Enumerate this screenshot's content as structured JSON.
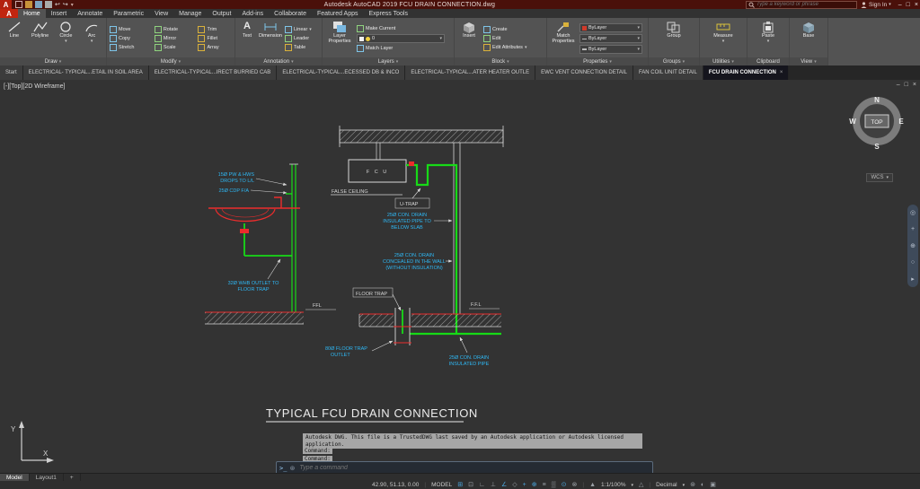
{
  "titlebar": {
    "title": "Autodesk AutoCAD 2019   FCU DRAIN CONNECTION.dwg",
    "search_placeholder": "Type a keyword or phrase",
    "signin": "Sign In"
  },
  "icons": {
    "minimize": "–",
    "maximize": "□",
    "close": "×",
    "undo": "↩",
    "redo": "↪",
    "prompt": ">_",
    "customize": "⊛",
    "dropdown": "▾"
  },
  "ribbon": {
    "tabs": [
      "Home",
      "Insert",
      "Annotate",
      "Parametric",
      "View",
      "Manage",
      "Output",
      "Add-ins",
      "Collaborate",
      "Featured Apps",
      "Express Tools"
    ],
    "draw": {
      "label": "Draw",
      "items": [
        "Line",
        "Polyline",
        "Circle",
        "Arc"
      ]
    },
    "modify": {
      "label": "Modify",
      "items": [
        "Move",
        "Rotate",
        "Trim",
        "Copy",
        "Mirror",
        "Fillet",
        "Stretch",
        "Scale",
        "Array"
      ]
    },
    "annotation": {
      "label": "Annotation",
      "big": [
        "Text",
        "Dimension"
      ],
      "small": [
        "Linear",
        "Leader",
        "Table"
      ]
    },
    "layers": {
      "label": "Layers",
      "big": "Layer Properties",
      "value": "0",
      "small": [
        "Make Current",
        "Match Layer"
      ]
    },
    "block": {
      "label": "Block",
      "big": "Insert",
      "small": [
        "Create",
        "Edit",
        "Edit Attributes"
      ]
    },
    "properties": {
      "label": "Properties",
      "big": "Match Properties",
      "dd": [
        "ByLayer",
        "ByLayer",
        "ByLayer"
      ]
    },
    "groups": {
      "label": "Groups",
      "big": "Group"
    },
    "utilities": {
      "label": "Utilities",
      "big": "Measure"
    },
    "clipboard": {
      "label": "Clipboard",
      "big": "Paste"
    },
    "view": {
      "label": "View",
      "big": "Base"
    }
  },
  "file_tabs": [
    "Start",
    "ELECTRICAL- TYPICAL...ETAIL IN SOIL AREA",
    "ELECTRICAL-TYPICAL...IRECT BURRIED CAB",
    "ELECTRICAL-TYPICAL...ECESSED DB & INCO",
    "ELECTRICAL-TYPICAL...ATER HEATER OUTLE",
    "EWC VENT CONNECTION DETAIL",
    "FAN COIL UNIT DETAIL",
    "FCU DRAIN CONNECTION"
  ],
  "viewport_label": "[-][Top][2D Wireframe]",
  "compass": {
    "n": "N",
    "e": "E",
    "s": "S",
    "w": "W",
    "top": "TOP",
    "wcs": "WCS"
  },
  "drawing": {
    "fcu_label": "F C U",
    "false_ceiling": "FALSE CEILING",
    "u_trap": "U-TRAP",
    "pw_hws_1": "15Ø PW & HWS",
    "pw_hws_2": "DROPS TO L/L",
    "cdp": "25Ø CDP F/A",
    "below_slab_1": "25Ø CON. DRAIN",
    "below_slab_2": "INSULATED PIPE TO",
    "below_slab_3": "BELOW SLAB",
    "wall_1": "25Ø CON. DRAIN",
    "wall_2": "CONCEALED IN THE WALL",
    "wall_3": "(WITHOUT INSULATION)",
    "whb_1": "32Ø WHB OUTLET TO",
    "whb_2": "FLOOR TRAP",
    "floor_trap": "FLOOR TRAP",
    "ffl_left": "FFL",
    "ffl_right": "F.F.L",
    "trap_outlet_1": "80Ø FLOOR TRAP",
    "trap_outlet_2": "OUTLET",
    "insulated_1": "25Ø CON. DRAIN",
    "insulated_2": "INSULATED PIPE",
    "title": "TYPICAL FCU DRAIN CONNECTION"
  },
  "command": {
    "trusted": "Autodesk DWG.  This file is a TrustedDWG last saved by an Autodesk application or Autodesk licensed application.",
    "prompt1": "Command:",
    "prompt2": "Command:",
    "placeholder": "Type a command"
  },
  "model_tabs": {
    "model": "Model",
    "layout": "Layout1",
    "add": "+"
  },
  "statusbar": {
    "coords": "42.90, 51.13, 0.00",
    "space": "MODEL",
    "scale": "1:1/100%",
    "units": "Decimal",
    "icons": {
      "grid": "⊞",
      "snap": "⊡",
      "infer": "∟",
      "ortho": "⊥",
      "polar": "∠",
      "iso": "◇",
      "otrack": "+",
      "osnap": "⊕",
      "lineweight": "≡",
      "transparency": "▒",
      "dyninput": "⊙",
      "cycling": "⊗",
      "annot_vis": "▲",
      "autoscale": "△",
      "workspace": "⊛",
      "isolate": "◐",
      "clean": "▣"
    }
  },
  "colors": {
    "titlebar_maroon": "#4a100a",
    "ribbon_gray": "#535353",
    "canvas_gray": "#333333",
    "pipe_green": "#17da17",
    "annotation_cyan": "#2eb8f5",
    "fixture_red": "#ed2c2c",
    "active_toggle_blue": "#4ba6dd"
  }
}
